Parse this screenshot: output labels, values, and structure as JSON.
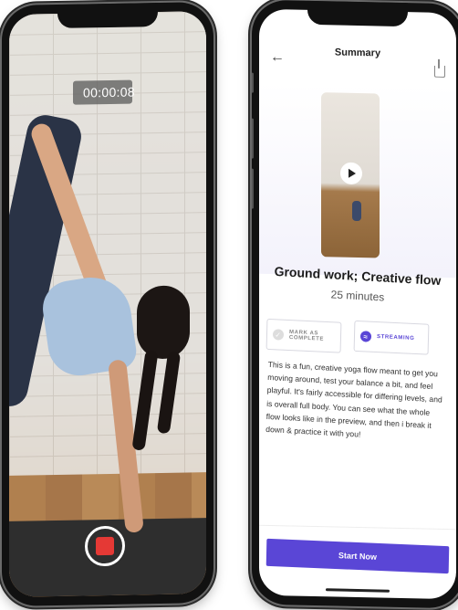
{
  "recorder": {
    "timer": "00:00:08",
    "record_icon": "stop-square-icon"
  },
  "summary": {
    "header_title": "Summary",
    "back_icon": "arrow-left-icon",
    "share_icon": "share-icon",
    "workout_title": "Ground work; Creative flow",
    "duration": "25 minutes",
    "mark_complete_label": "MARK AS COMPLETE",
    "streaming_label": "STREAMING",
    "description": "This is a fun, creative yoga flow meant to get you moving around, test your balance a bit, and feel playful. It's fairly accessible for differing levels, and is overall full body. You can see what the whole flow looks like in the preview, and then i break it down & practice it with you!",
    "start_label": "Start Now"
  },
  "colors": {
    "accent": "#5a46d6",
    "record": "#e53935"
  }
}
